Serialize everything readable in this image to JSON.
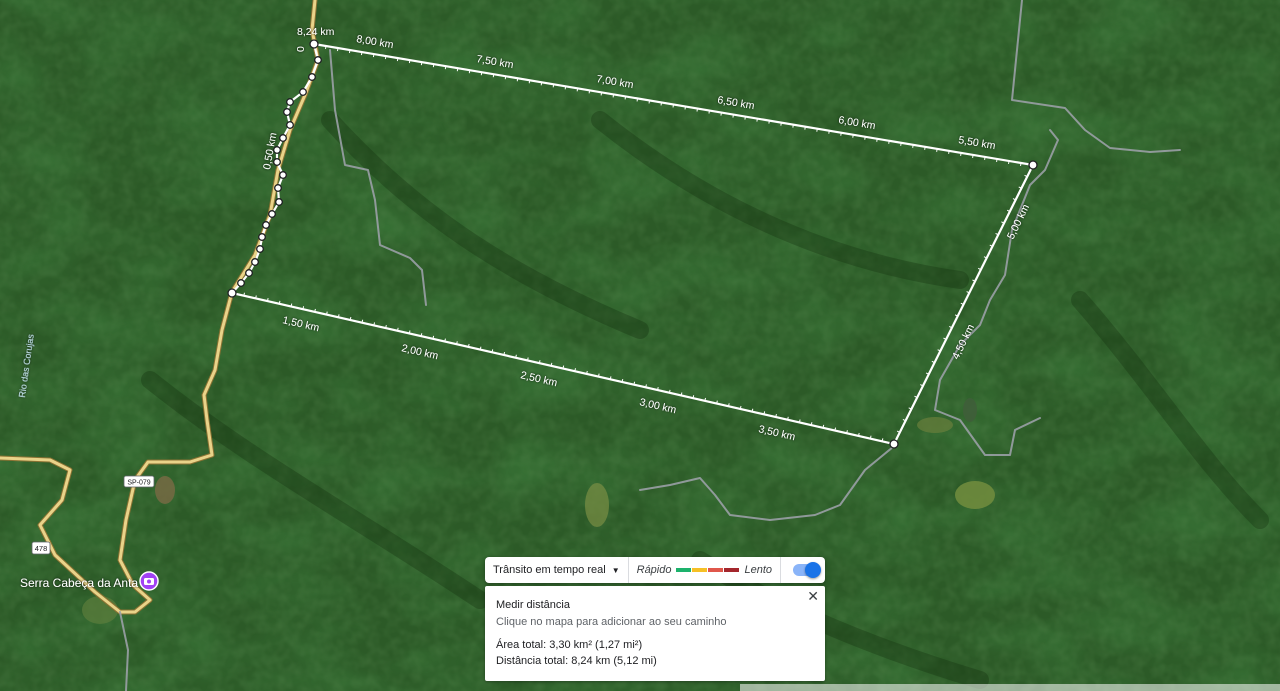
{
  "map": {
    "total_label": "8,24 km",
    "origin_label": "0",
    "distance_labels": [
      "0,50 km",
      "1,50 km",
      "2,00 km",
      "2,50 km",
      "3,00 km",
      "3,50 km",
      "4,50 km",
      "5,00 km",
      "5,50 km",
      "6,00 km",
      "6,50 km",
      "7,00 km",
      "7,50 km",
      "8,00 km"
    ],
    "place_label": "Serra Cabeça da Anta",
    "river_label": "Rio das Corujas",
    "road_shields": [
      "SP-079",
      "478"
    ]
  },
  "traffic_bar": {
    "dropdown_label": "Trânsito em tempo real",
    "fast_label": "Rápido",
    "slow_label": "Lento",
    "colors": [
      "#1db26c",
      "#f6c026",
      "#e0574b",
      "#a4262c"
    ],
    "toggle_on": true
  },
  "measure_panel": {
    "title": "Medir distância",
    "hint": "Clique no mapa para adicionar ao seu caminho",
    "area": "Área total: 3,30 km² (1,27 mi²)",
    "distance": "Distância total: 8,24 km (5,12 mi)",
    "close_icon": "close-icon"
  }
}
